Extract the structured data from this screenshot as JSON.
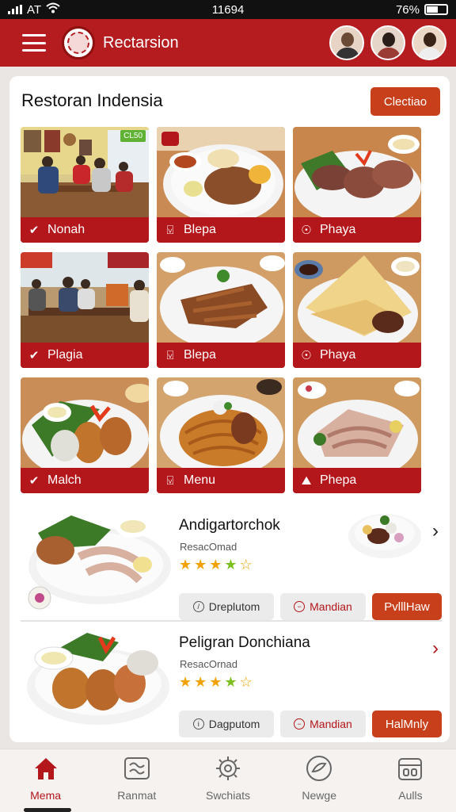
{
  "status_bar": {
    "carrier": "AT",
    "time": "11694",
    "battery": "76%"
  },
  "header": {
    "app_title": "Rectarsion",
    "menu_icon": "hamburger-icon",
    "avatars": [
      "avatar-1",
      "avatar-2",
      "avatar-3"
    ]
  },
  "section": {
    "title": "Restoran Indensia",
    "action_label": "Clectiao"
  },
  "grid": [
    {
      "label": "Nonah",
      "icon": "check-icon",
      "badge": "CL50"
    },
    {
      "label": "Blepa",
      "icon": "bookmark-icon"
    },
    {
      "label": "Phaya",
      "icon": "dish-icon"
    },
    {
      "label": "Plagia",
      "icon": "check-icon"
    },
    {
      "label": "Blepa",
      "icon": "bookmark-icon"
    },
    {
      "label": "Phaya",
      "icon": "dish-icon"
    },
    {
      "label": "Malch",
      "icon": "check-icon"
    },
    {
      "label": "Menu",
      "icon": "bookmark-icon"
    },
    {
      "label": "Phepa",
      "icon": "image-icon"
    }
  ],
  "restaurants": [
    {
      "name": "Andigartorchok",
      "subtitle": "ResacOmad",
      "rating": 4,
      "pills": [
        "Dreplutom",
        "Mandian"
      ],
      "action_label": "PvlllHaw"
    },
    {
      "name": "Peligran Donchiana",
      "subtitle": "ResacOrnad",
      "rating": 4,
      "pills": [
        "Dagputom",
        "Mandian"
      ],
      "action_label": "HalMnly"
    }
  ],
  "bottom_nav": [
    {
      "label": "Mema",
      "icon": "home-icon",
      "active": true
    },
    {
      "label": "Ranmat",
      "icon": "map-icon",
      "active": false
    },
    {
      "label": "Swchiats",
      "icon": "gear-icon",
      "active": false
    },
    {
      "label": "Newge",
      "icon": "compass-icon",
      "active": false
    },
    {
      "label": "Aulls",
      "icon": "wallet-icon",
      "active": false
    }
  ],
  "colors": {
    "brand": "#b41c1f",
    "accent": "#c8401b",
    "star": "#f2a200",
    "star_green": "#7cbf1e"
  }
}
